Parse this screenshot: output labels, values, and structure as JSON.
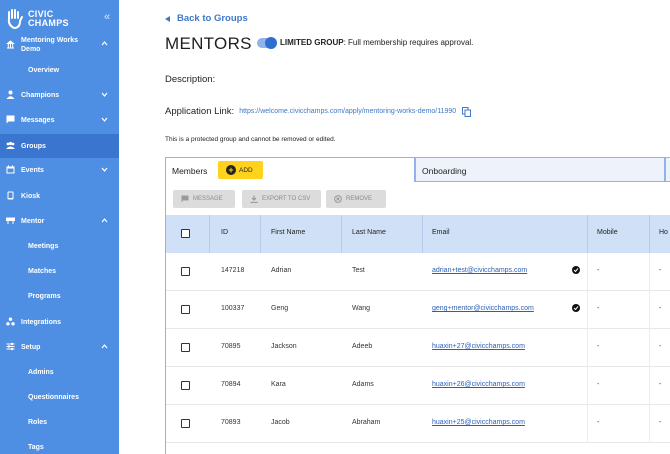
{
  "sidebar": {
    "logo_line1": "CIVIC",
    "logo_line2": "CHAMPS",
    "collapse_icon": "double-chevron-left-icon",
    "items": [
      {
        "label_line1": "Mentoring Works",
        "label_line2": "Demo",
        "icon": "building-icon"
      },
      {
        "label": "Overview"
      },
      {
        "label": "Champions",
        "icon": "person-icon"
      },
      {
        "label": "Messages",
        "icon": "message-icon"
      },
      {
        "label": "Groups",
        "icon": "groups-icon"
      },
      {
        "label": "Events",
        "icon": "calendar-icon"
      },
      {
        "label": "Kiosk",
        "icon": "tablet-icon"
      },
      {
        "label": "Mentor",
        "icon": "mentor-icon"
      },
      {
        "label": "Meetings"
      },
      {
        "label": "Matches"
      },
      {
        "label": "Programs"
      },
      {
        "label": "Integrations",
        "icon": "integrations-icon"
      },
      {
        "label": "Setup",
        "icon": "setup-icon"
      },
      {
        "label": "Admins"
      },
      {
        "label": "Questionnaires"
      },
      {
        "label": "Roles"
      },
      {
        "label": "Tags"
      }
    ]
  },
  "header": {
    "back_label": "Back to Groups",
    "title": "MENTORS",
    "limited_group_label": "LIMITED GROUP",
    "limited_group_text": ": Full membership requires approval.",
    "limited_group_enabled": true
  },
  "details": {
    "description_label": "Description:",
    "application_link_label": "Application Link:",
    "application_link_url": "https://welcome.civicchamps.com/apply/mentoring-works-demo/11990",
    "protected_note": "This is a protected group and cannot be removed or edited."
  },
  "tabs": {
    "members_label": "Members",
    "add_label": "ADD",
    "onboarding_label": "Onboarding"
  },
  "actions": {
    "message_label": "MESSAGE",
    "export_label": "EXPORT TO CSV",
    "remove_label": "REMOVE"
  },
  "table": {
    "columns": [
      "ID",
      "First Name",
      "Last Name",
      "Email",
      "Mobile",
      "Ho"
    ],
    "rows": [
      {
        "id": "147218",
        "first": "Adrian",
        "last": "Test",
        "email": "adrian+test@civicchamps.com",
        "verified": true,
        "mobile": "-",
        "home": "-"
      },
      {
        "id": "100337",
        "first": "Geng",
        "last": "Wang",
        "email": "geng+mentor@civicchamps.com",
        "verified": true,
        "mobile": "-",
        "home": "-"
      },
      {
        "id": "70895",
        "first": "Jackson",
        "last": "Adeeb",
        "email": "huaxin+27@civicchamps.com",
        "verified": false,
        "mobile": "-",
        "home": "-"
      },
      {
        "id": "70894",
        "first": "Kara",
        "last": "Adams",
        "email": "huaxin+26@civicchamps.com",
        "verified": false,
        "mobile": "-",
        "home": "-"
      },
      {
        "id": "70893",
        "first": "Jacob",
        "last": "Abraham",
        "email": "huaxin+25@civicchamps.com",
        "verified": false,
        "mobile": "-",
        "home": "-"
      }
    ]
  },
  "colors": {
    "sidebar_bg": "#4f8fe3",
    "sidebar_active": "#3a76cf",
    "accent": "#3f78c7",
    "add_button": "#ffd21e",
    "table_header": "#cfe0f7"
  }
}
